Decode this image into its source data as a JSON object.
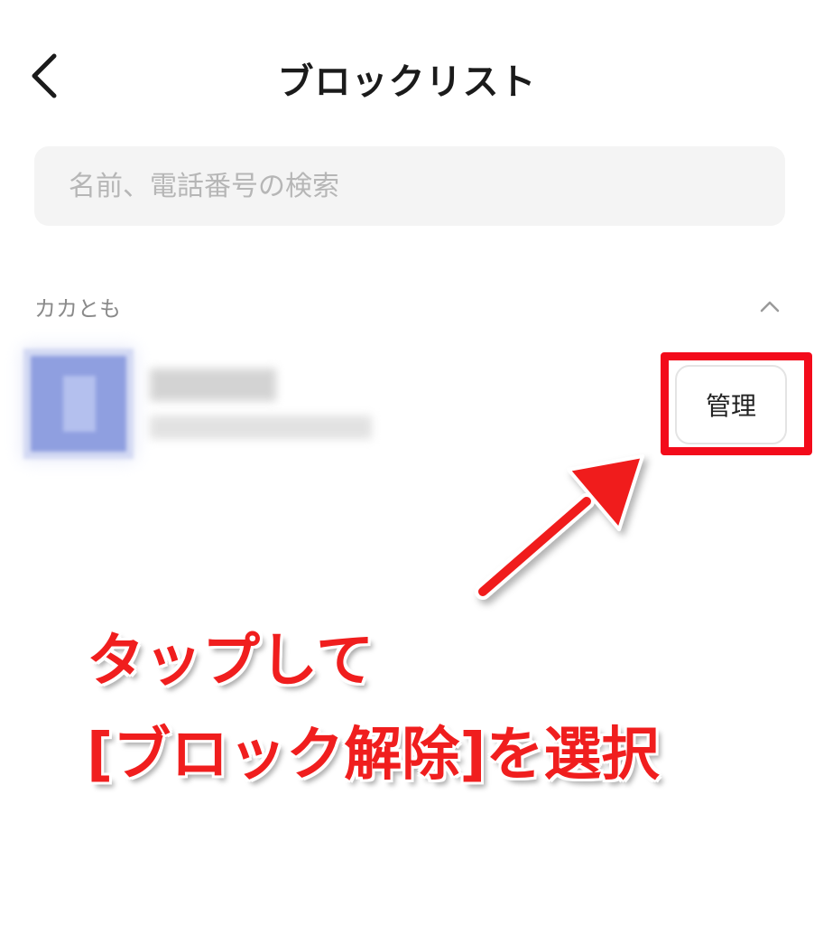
{
  "header": {
    "title": "ブロックリスト"
  },
  "search": {
    "placeholder": "名前、電話番号の検索"
  },
  "section": {
    "label": "カカとも"
  },
  "contact": {
    "manage_label": "管理"
  },
  "annotation": {
    "line1": "タップして",
    "line2": "[ブロック解除]を選択"
  },
  "colors": {
    "annotation_red": "#f01e1e",
    "highlight_red": "#f30b1b",
    "search_bg": "#f4f4f4",
    "avatar_blue": "#8f9fe0"
  },
  "icons": {
    "back": "chevron-left-icon",
    "collapse": "chevron-up-icon",
    "pointer": "arrow-icon"
  }
}
